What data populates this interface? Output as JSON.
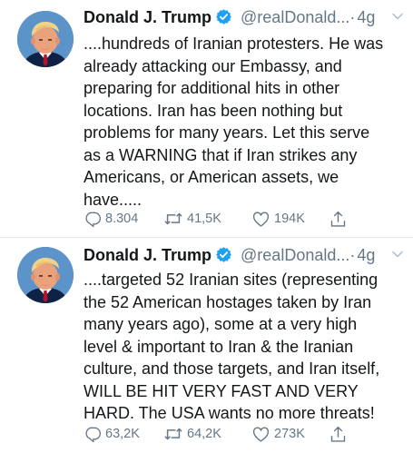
{
  "tweets": [
    {
      "name": "Donald J. Trump",
      "handle": "@realDonald...",
      "separator": "·",
      "time": "4g",
      "lines": [
        "....hundreds of Iranian protesters. He was",
        "already attacking our Embassy, and",
        "preparing for additional hits in other",
        "locations. Iran has been nothing but",
        "problems for many years. Let this serve",
        "as a WARNING that if Iran strikes any",
        "Americans, or American assets, we",
        "have....."
      ],
      "replies": "8.304",
      "retweets": "41,5K",
      "likes": "194K"
    },
    {
      "name": "Donald J. Trump",
      "handle": "@realDonald...",
      "separator": "·",
      "time": "4g",
      "lines": [
        "....targeted 52 Iranian sites (representing",
        "the 52 American hostages taken by Iran",
        "many years ago), some at a very high",
        "level & important to Iran &  the Iranian",
        "culture, and those targets, and Iran itself,",
        "WILL BE HIT VERY FAST AND VERY",
        "HARD. The USA wants no more threats!"
      ],
      "replies": "63,2K",
      "retweets": "64,2K",
      "likes": "273K"
    }
  ],
  "colors": {
    "text": "#14171a",
    "secondary": "#657786",
    "verified": "#1da1f2",
    "divider": "#e1e8ed",
    "avatar_bg": "#5c93c9"
  },
  "icons": [
    "verified-badge-icon",
    "chevron-down-icon",
    "reply-icon",
    "retweet-icon",
    "like-icon",
    "share-icon"
  ]
}
